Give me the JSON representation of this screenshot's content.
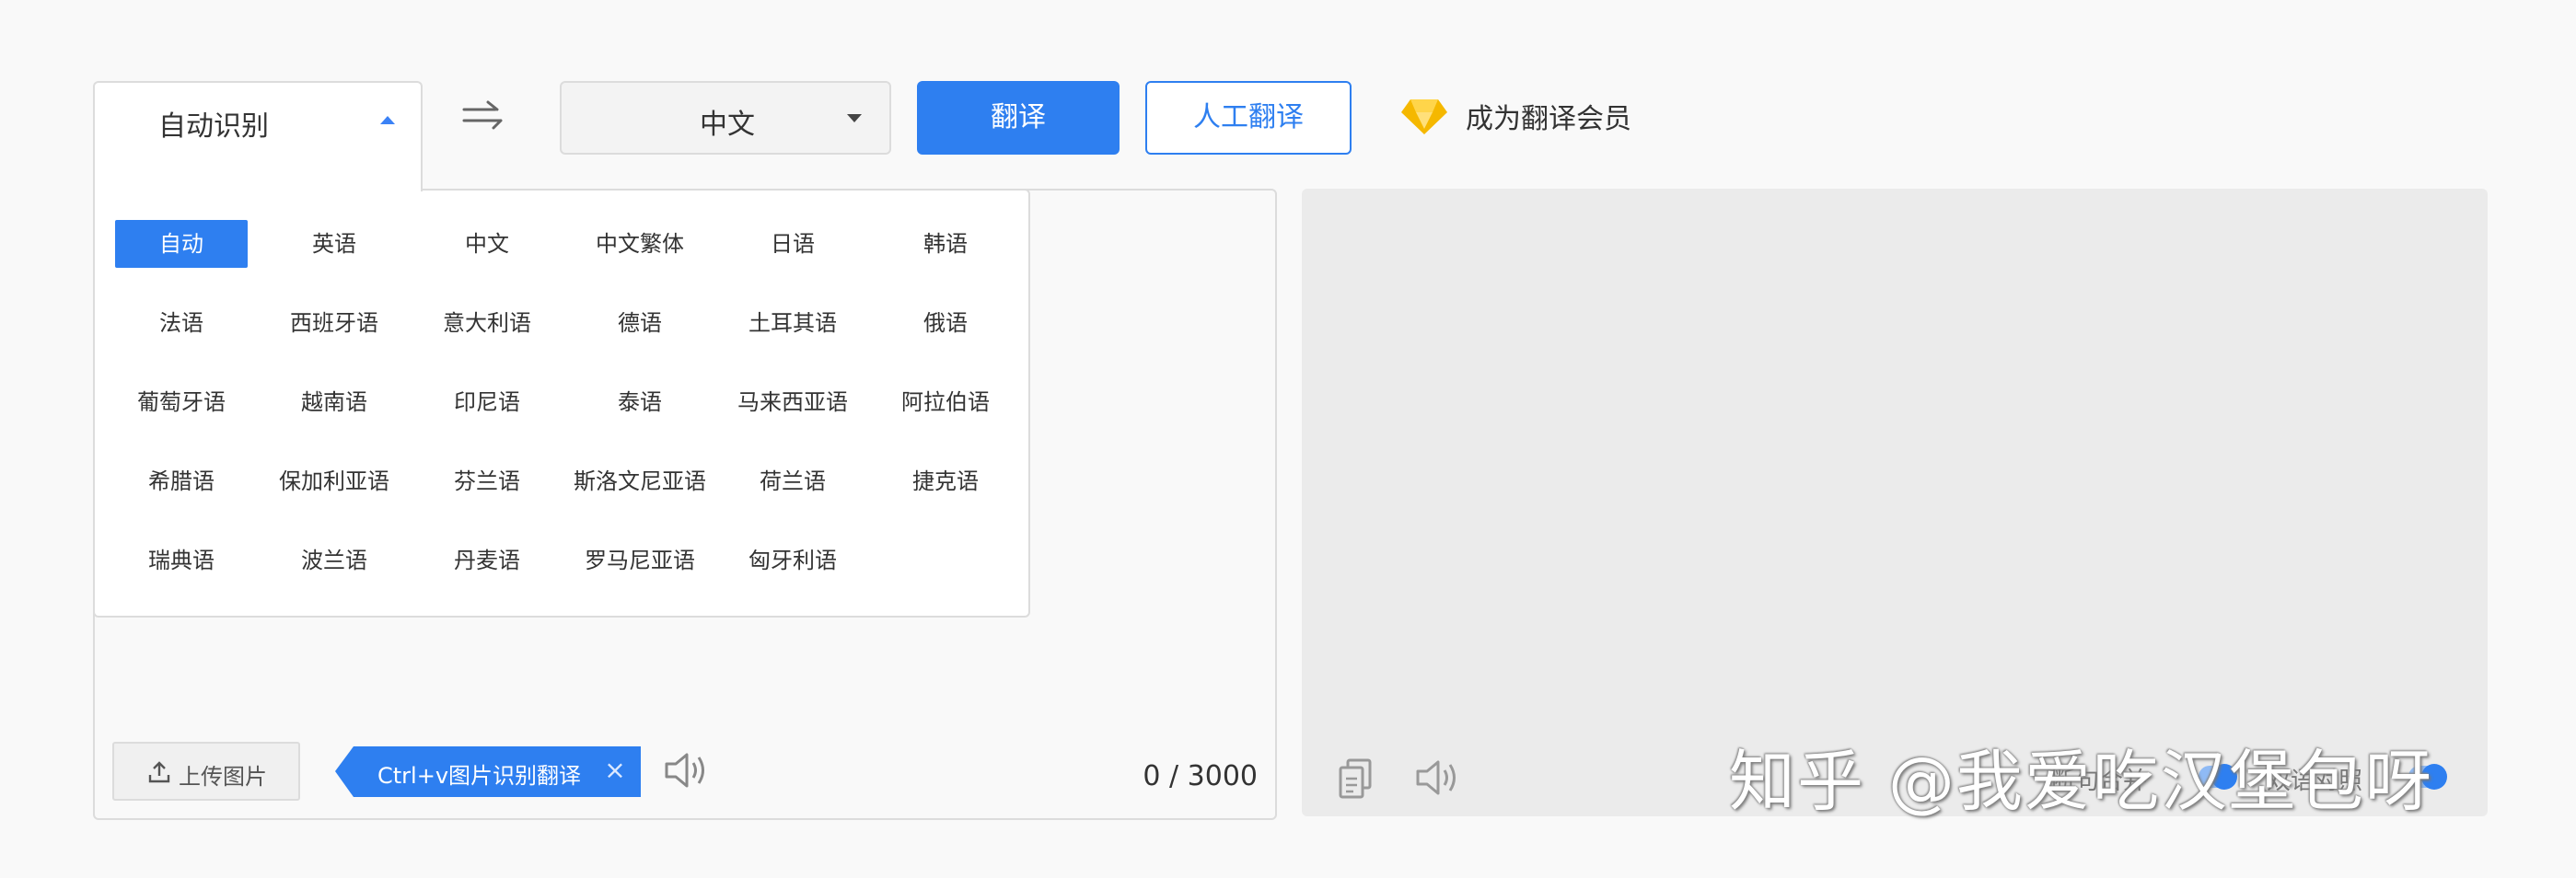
{
  "source_lang": {
    "label": "自动识别"
  },
  "target_lang": {
    "label": "中文"
  },
  "buttons": {
    "translate": "翻译",
    "human_translate": "人工翻译",
    "vip": "成为翻译会员"
  },
  "dropdown": {
    "languages": [
      "自动",
      "英语",
      "中文",
      "中文繁体",
      "日语",
      "韩语",
      "法语",
      "西班牙语",
      "意大利语",
      "德语",
      "土耳其语",
      "俄语",
      "葡萄牙语",
      "越南语",
      "印尼语",
      "泰语",
      "马来西亚语",
      "阿拉伯语",
      "希腊语",
      "保加利亚语",
      "芬兰语",
      "斯洛文尼亚语",
      "荷兰语",
      "捷克语",
      "瑞典语",
      "波兰语",
      "丹麦语",
      "罗马尼亚语",
      "匈牙利语"
    ],
    "selected": "自动"
  },
  "input_toolbar": {
    "upload_label": "上传图片",
    "tip_label": "Ctrl+v图片识别翻译",
    "tip_close": "×",
    "counter": "0 / 3000"
  },
  "output_toolbar": {
    "option1": "断句合并",
    "option2": "双语对照"
  },
  "watermark": "知乎 @我爱吃汉堡包呀",
  "colors": {
    "accent": "#2e7ff0",
    "vip_gold": "#f5b800"
  }
}
